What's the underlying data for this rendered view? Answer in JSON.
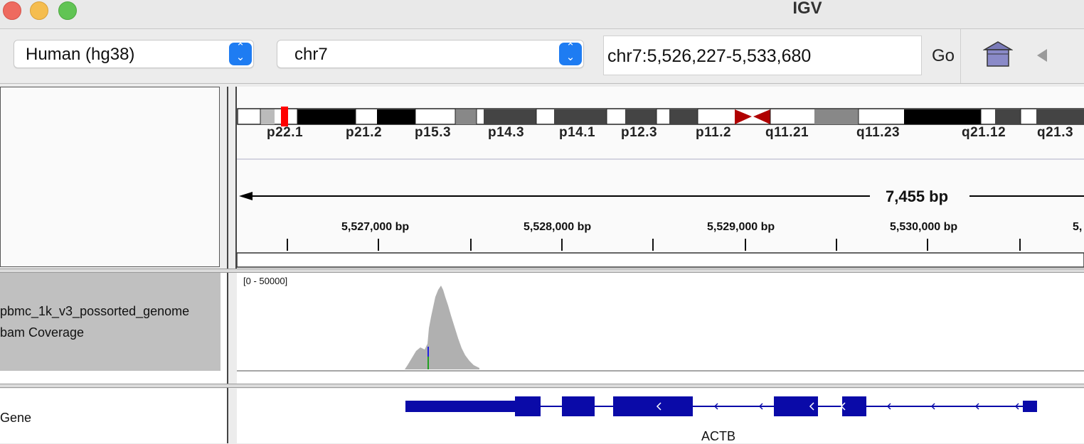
{
  "window": {
    "title": "IGV"
  },
  "toolbar": {
    "genome": "Human (hg38)",
    "chromosome": "chr7",
    "locus": "chr7:5,526,227-5,533,680",
    "go_label": "Go"
  },
  "ideogram": {
    "bands": [
      "p22.1",
      "p21.2",
      "p15.3",
      "p14.3",
      "p14.1",
      "p12.3",
      "p11.2",
      "q11.21",
      "q11.23",
      "q21.12",
      "q21.3"
    ]
  },
  "ruler": {
    "span": "7,455 bp",
    "ticks": [
      "5,527,000 bp",
      "5,528,000 bp",
      "5,529,000 bp",
      "5,530,000 bp",
      "5,"
    ]
  },
  "tracks": {
    "coverage": {
      "name_line1": "pbmc_1k_v3_possorted_genome",
      "name_line2": "bam Coverage",
      "range": "[0 - 50000]"
    },
    "gene": {
      "name": "Gene",
      "feature": "ACTB"
    }
  },
  "colors": {
    "gene": "#0a0aa8",
    "coverage": "#b0b0b0",
    "centromere": "#b00000",
    "current_region": "#ff0000"
  }
}
